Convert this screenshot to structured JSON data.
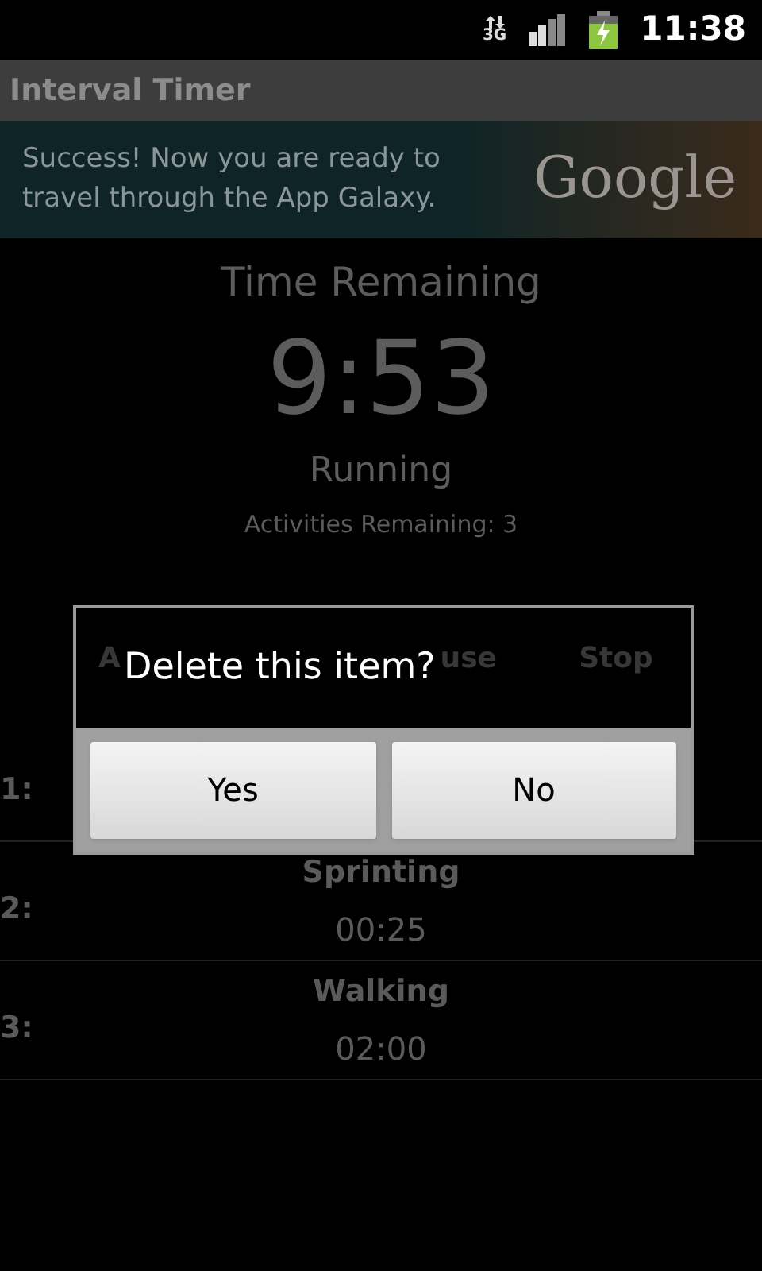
{
  "status_bar": {
    "network": "3G",
    "time": "11:38"
  },
  "title_bar": {
    "title": "Interval Timer"
  },
  "ad_banner": {
    "text": "Success! Now you are ready to travel through the App Galaxy.",
    "logo": "Google"
  },
  "timer": {
    "heading": "Time Remaining",
    "time": "9:53",
    "state": "Running",
    "activities_remaining": "Activities Remaining: 3"
  },
  "controls": [
    {
      "kind": "labeled",
      "label": "A"
    },
    {
      "kind": "blank"
    },
    {
      "kind": "labeled",
      "label": "use"
    },
    {
      "kind": "labeled",
      "label": "Stop"
    }
  ],
  "activities": [
    {
      "number": "1:"
    },
    {
      "number": "2:",
      "name": "Sprinting",
      "duration": "00:25"
    },
    {
      "number": "3:",
      "name": "Walking",
      "duration": "02:00"
    }
  ],
  "dialog": {
    "title": "Delete this item?",
    "buttons": [
      "Yes",
      "No"
    ]
  }
}
